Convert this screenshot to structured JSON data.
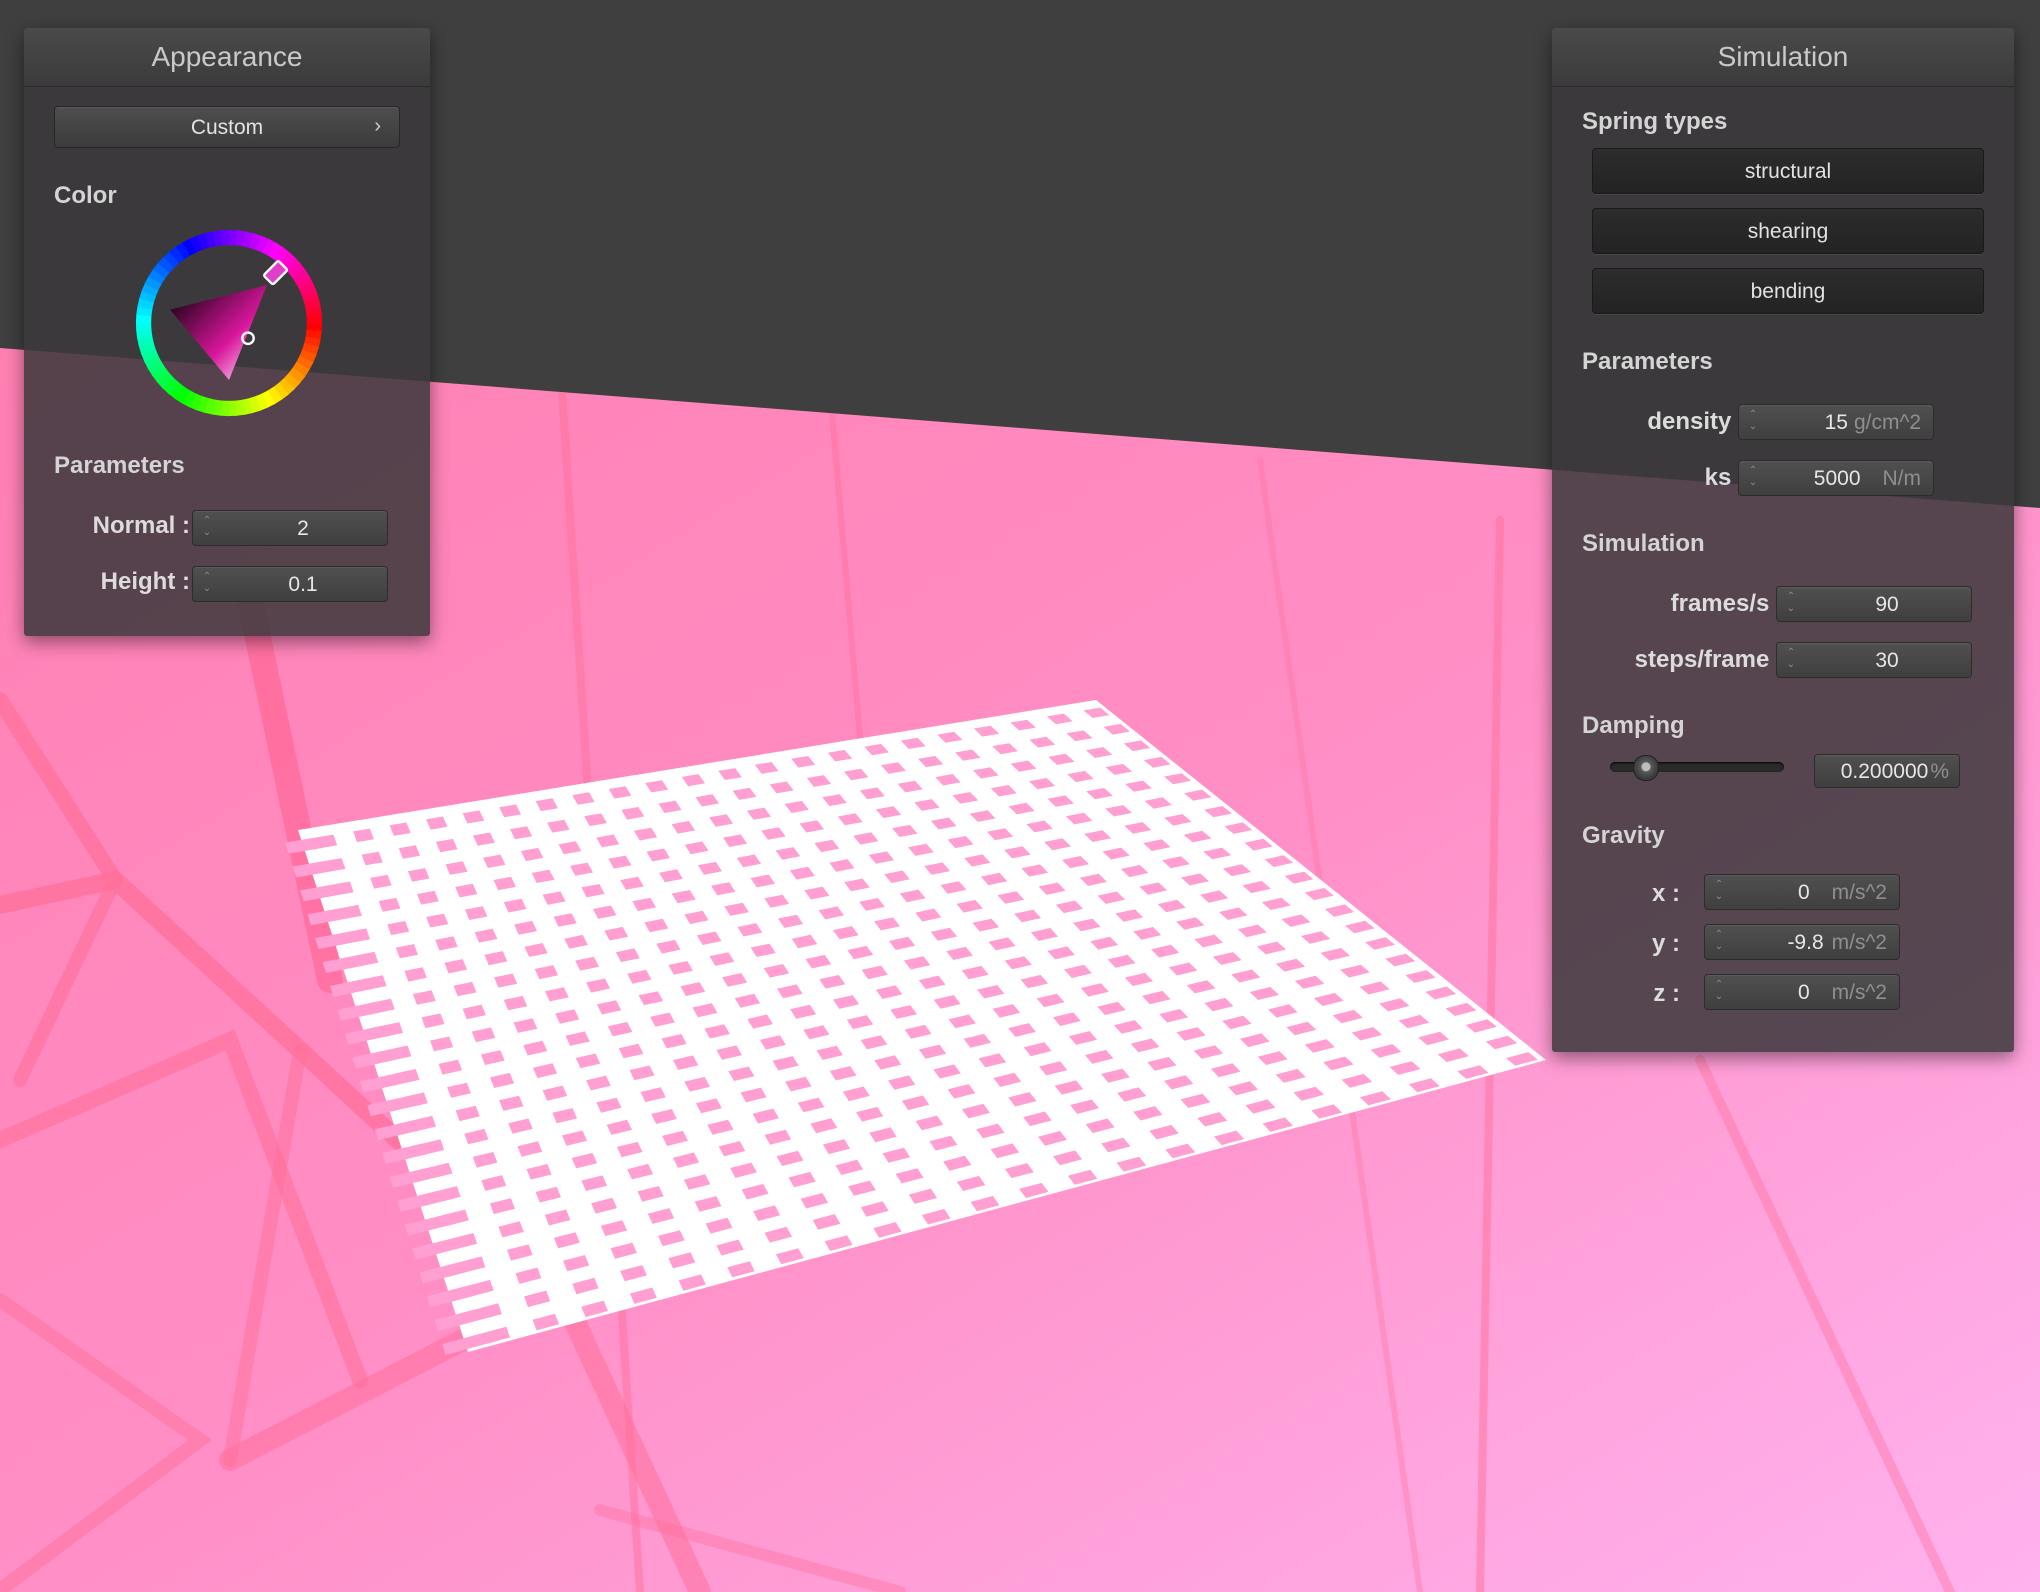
{
  "appearance": {
    "title": "Appearance",
    "preset_label": "Custom",
    "chevron_icon": "chevron-right-icon",
    "color_label": "Color",
    "selected_color": "#e040c8",
    "parameters_label": "Parameters",
    "normal_label": "Normal :",
    "normal_value": "2",
    "height_label": "Height :",
    "height_value": "0.1"
  },
  "simulation": {
    "title": "Simulation",
    "spring_types_label": "Spring types",
    "spring_types": [
      "structural",
      "shearing",
      "bending"
    ],
    "parameters_label": "Parameters",
    "density_label": "density :",
    "density_value": "15",
    "density_unit": "g/cm^2",
    "ks_label": "ks :",
    "ks_value": "5000",
    "ks_unit": "N/m",
    "simulation_label": "Simulation",
    "fps_label": "frames/s :",
    "fps_value": "90",
    "steps_label": "steps/frame :",
    "steps_value": "30",
    "damping_label": "Damping",
    "damping_value": "0.200000",
    "damping_unit": "%",
    "damping_fraction": 0.2,
    "gravity_label": "Gravity",
    "gravity": [
      {
        "label": "x :",
        "value": "0",
        "unit": "m/s^2"
      },
      {
        "label": "y :",
        "value": "-9.8",
        "unit": "m/s^2"
      },
      {
        "label": "z :",
        "value": "0",
        "unit": "m/s^2"
      }
    ]
  },
  "scene": {
    "background_color": "#3f3f3f",
    "floor_color": "#ff8ec8",
    "cloth_color": "#ffffff",
    "cloth_hole_color": "#ff9fd2"
  }
}
